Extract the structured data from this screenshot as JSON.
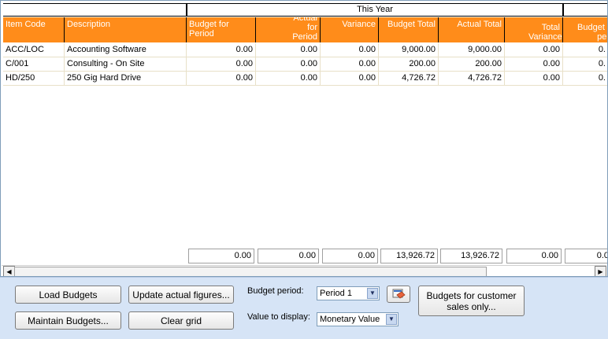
{
  "grid": {
    "group_header": "This Year",
    "columns": [
      {
        "label": "Item Code"
      },
      {
        "label": "Description"
      },
      {
        "label": "Budget for Period"
      },
      {
        "label": "Actual for Period"
      },
      {
        "label": "Variance"
      },
      {
        "label": "Budget Total"
      },
      {
        "label": "Actual Total"
      },
      {
        "label": "Total Variance"
      },
      {
        "label": "Budget f per"
      }
    ],
    "rows": [
      {
        "item_code": "ACC/LOC",
        "description": "Accounting Software",
        "budget_period": "0.00",
        "actual_period": "0.00",
        "variance": "0.00",
        "budget_total": "9,000.00",
        "actual_total": "9,000.00",
        "total_variance": "0.00",
        "next": "0."
      },
      {
        "item_code": "C/001",
        "description": "Consulting - On Site",
        "budget_period": "0.00",
        "actual_period": "0.00",
        "variance": "0.00",
        "budget_total": "200.00",
        "actual_total": "200.00",
        "total_variance": "0.00",
        "next": "0."
      },
      {
        "item_code": "HD/250",
        "description": "250 Gig Hard Drive",
        "budget_period": "0.00",
        "actual_period": "0.00",
        "variance": "0.00",
        "budget_total": "4,726.72",
        "actual_total": "4,726.72",
        "total_variance": "0.00",
        "next": "0."
      }
    ],
    "totals": {
      "budget_period": "0.00",
      "actual_period": "0.00",
      "variance": "0.00",
      "budget_total": "13,926.72",
      "actual_total": "13,926.72",
      "total_variance": "0.00",
      "next": "0.0"
    }
  },
  "controls": {
    "load_budgets": "Load Budgets",
    "maintain_budgets": "Maintain Budgets...",
    "update_actual": "Update actual figures...",
    "clear_grid": "Clear grid",
    "budget_period_label": "Budget period:",
    "budget_period_value": "Period 1",
    "value_display_label": "Value to display:",
    "value_display_value": "Monetary Value",
    "customer_budgets_line1": "Budgets for customer",
    "customer_budgets_line2": "sales only..."
  },
  "colors": {
    "header_bg": "#ff8c1a",
    "panel_bg": "#d6e4f6"
  }
}
